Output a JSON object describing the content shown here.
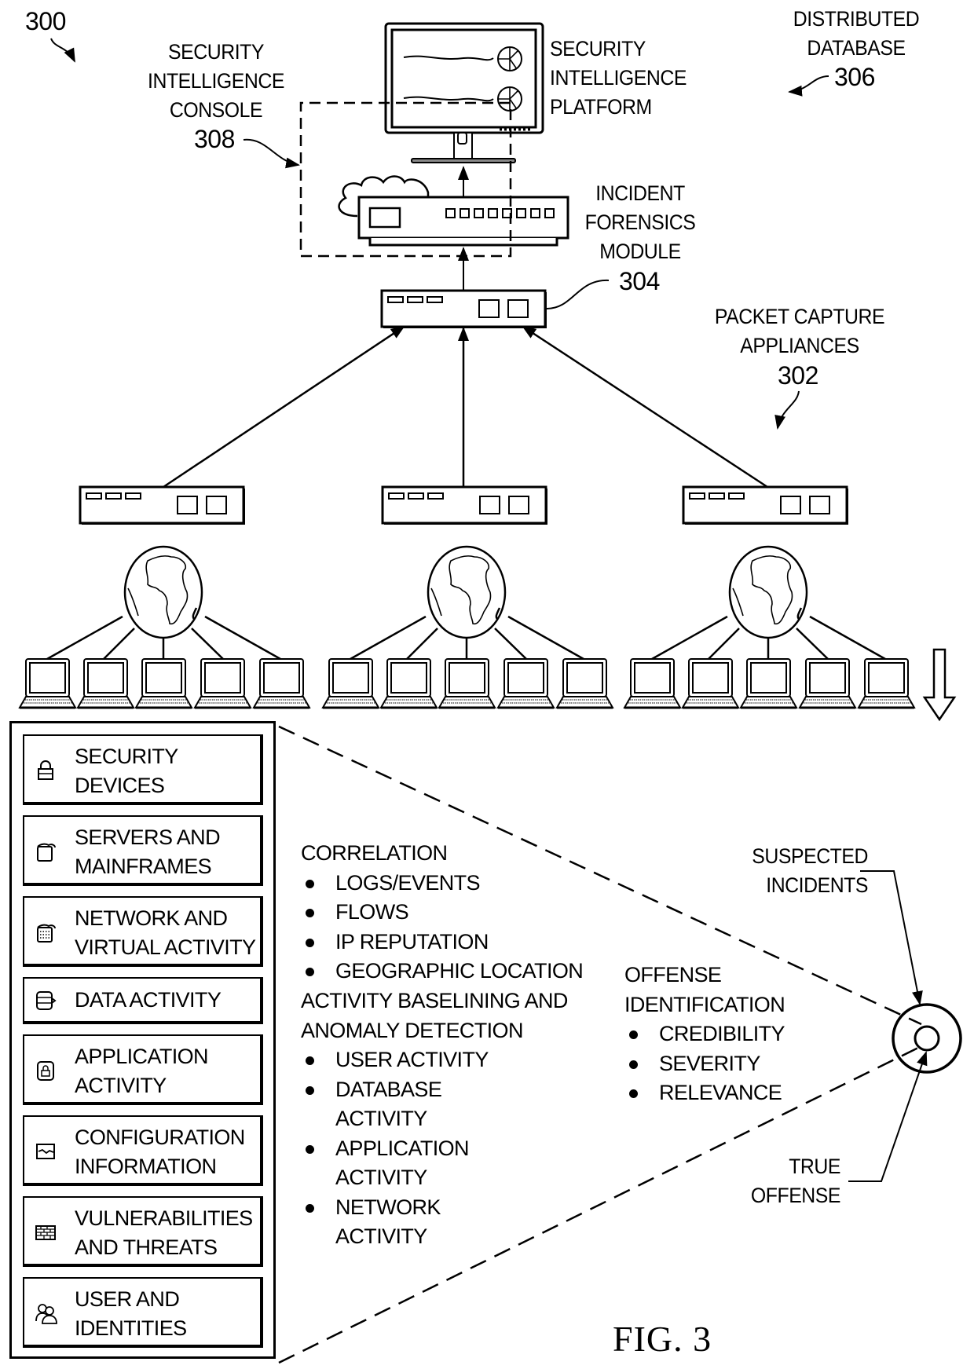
{
  "figure": {
    "ref_number": "300",
    "caption": "FIG. 3"
  },
  "labels": {
    "console": {
      "lines": [
        "SECURITY",
        "INTELLIGENCE",
        "CONSOLE"
      ],
      "ref": "308"
    },
    "platform": {
      "lines": [
        "SECURITY",
        "INTELLIGENCE",
        "PLATFORM"
      ]
    },
    "database": {
      "lines": [
        "DISTRIBUTED",
        "DATABASE"
      ],
      "ref": "306"
    },
    "forensics": {
      "lines": [
        "INCIDENT",
        "FORENSICS",
        "MODULE"
      ],
      "ref": "304"
    },
    "capture": {
      "lines": [
        "PACKET CAPTURE",
        "APPLIANCES"
      ],
      "ref": "302"
    },
    "suspected": {
      "lines": [
        "SUSPECTED",
        "INCIDENTS"
      ]
    },
    "true_offense": {
      "lines": [
        "TRUE",
        "OFFENSE"
      ]
    }
  },
  "network": {
    "capture_appliance_count": 3,
    "globe_count": 3,
    "laptops_per_globe": 5
  },
  "data_sources": [
    {
      "icon": "lock-icon",
      "lines": [
        "SECURITY",
        "DEVICES"
      ]
    },
    {
      "icon": "server-icon",
      "lines": [
        "SERVERS AND",
        "MAINFRAMES"
      ]
    },
    {
      "icon": "network-icon",
      "lines": [
        "NETWORK AND",
        "VIRTUAL ACTIVITY"
      ]
    },
    {
      "icon": "database-icon",
      "lines": [
        "DATA ACTIVITY"
      ]
    },
    {
      "icon": "application-icon",
      "lines": [
        "APPLICATION",
        "ACTIVITY"
      ]
    },
    {
      "icon": "chart-icon",
      "lines": [
        "CONFIGURATION",
        "INFORMATION"
      ]
    },
    {
      "icon": "firewall-icon",
      "lines": [
        "VULNERABILITIES",
        "AND THREATS"
      ]
    },
    {
      "icon": "users-icon",
      "lines": [
        "USER AND",
        "IDENTITIES"
      ]
    }
  ],
  "analysis": {
    "correlation": {
      "heading": "CORRELATION",
      "items": [
        [
          "LOGS/EVENTS"
        ],
        [
          "FLOWS"
        ],
        [
          "IP REPUTATION"
        ],
        [
          "GEOGRAPHIC LOCATION"
        ]
      ]
    },
    "baselining": {
      "heading": [
        "ACTIVITY BASELINING AND",
        "ANOMALY DETECTION"
      ],
      "items": [
        [
          "USER ACTIVITY"
        ],
        [
          "DATABASE",
          "ACTIVITY"
        ],
        [
          "APPLICATION",
          "ACTIVITY"
        ],
        [
          "NETWORK",
          "ACTIVITY"
        ]
      ]
    },
    "offense": {
      "heading": [
        "OFFENSE",
        "IDENTIFICATION"
      ],
      "items": [
        [
          "CREDIBILITY"
        ],
        [
          "SEVERITY"
        ],
        [
          "RELEVANCE"
        ]
      ]
    }
  }
}
